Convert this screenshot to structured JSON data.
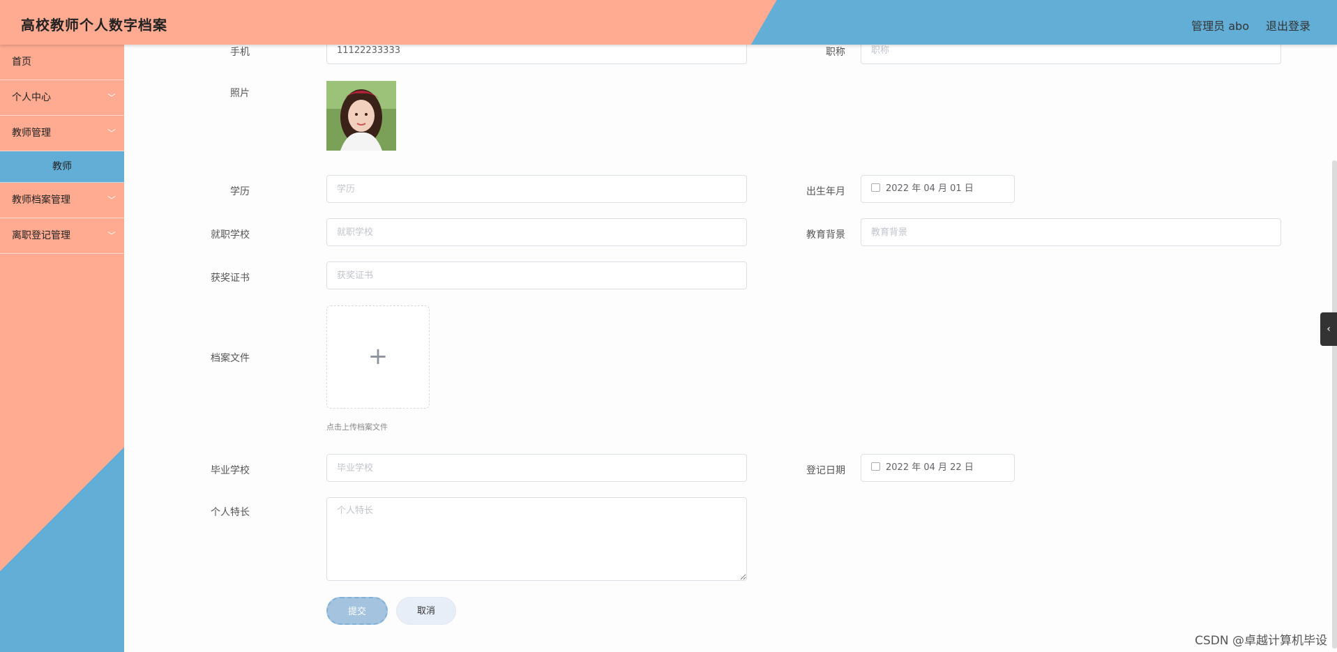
{
  "header": {
    "title": "高校教师个人数字档案",
    "admin_label": "管理员 abo",
    "logout_label": "退出登录"
  },
  "sidebar": {
    "items": [
      {
        "label": "首页"
      },
      {
        "label": "个人中心",
        "icon": "chevron-down-icon"
      },
      {
        "label": "教师管理",
        "icon": "chevron-down-icon"
      },
      {
        "label": "教师",
        "sub": true
      },
      {
        "label": "教师档案管理",
        "icon": "chevron-down-icon"
      },
      {
        "label": "离职登记管理",
        "icon": "chevron-down-icon"
      }
    ]
  },
  "form": {
    "phone": {
      "label": "手机",
      "value": "11122233333"
    },
    "title": {
      "label": "职称",
      "placeholder": "职称"
    },
    "photo": {
      "label": "照片"
    },
    "education": {
      "label": "学历",
      "placeholder": "学历"
    },
    "birth": {
      "label": "出生年月",
      "value": "2022 年 04 月 01 日"
    },
    "school": {
      "label": "就职学校",
      "placeholder": "就职学校"
    },
    "background": {
      "label": "教育背景",
      "placeholder": "教育背景"
    },
    "award": {
      "label": "获奖证书",
      "placeholder": "获奖证书"
    },
    "archive": {
      "label": "档案文件",
      "plus": "+",
      "hint": "点击上传档案文件"
    },
    "grad_school": {
      "label": "毕业学校",
      "placeholder": "毕业学校"
    },
    "register_date": {
      "label": "登记日期",
      "value": "2022 年 04 月 22 日"
    },
    "specialty": {
      "label": "个人特长",
      "placeholder": "个人特长"
    },
    "submit_label": "提交",
    "cancel_label": "取消"
  },
  "side_toggle": "‹",
  "watermark": "CSDN @卓越计算机毕设",
  "colors": {
    "salmon": "#ffab92",
    "blue": "#62aed6"
  }
}
